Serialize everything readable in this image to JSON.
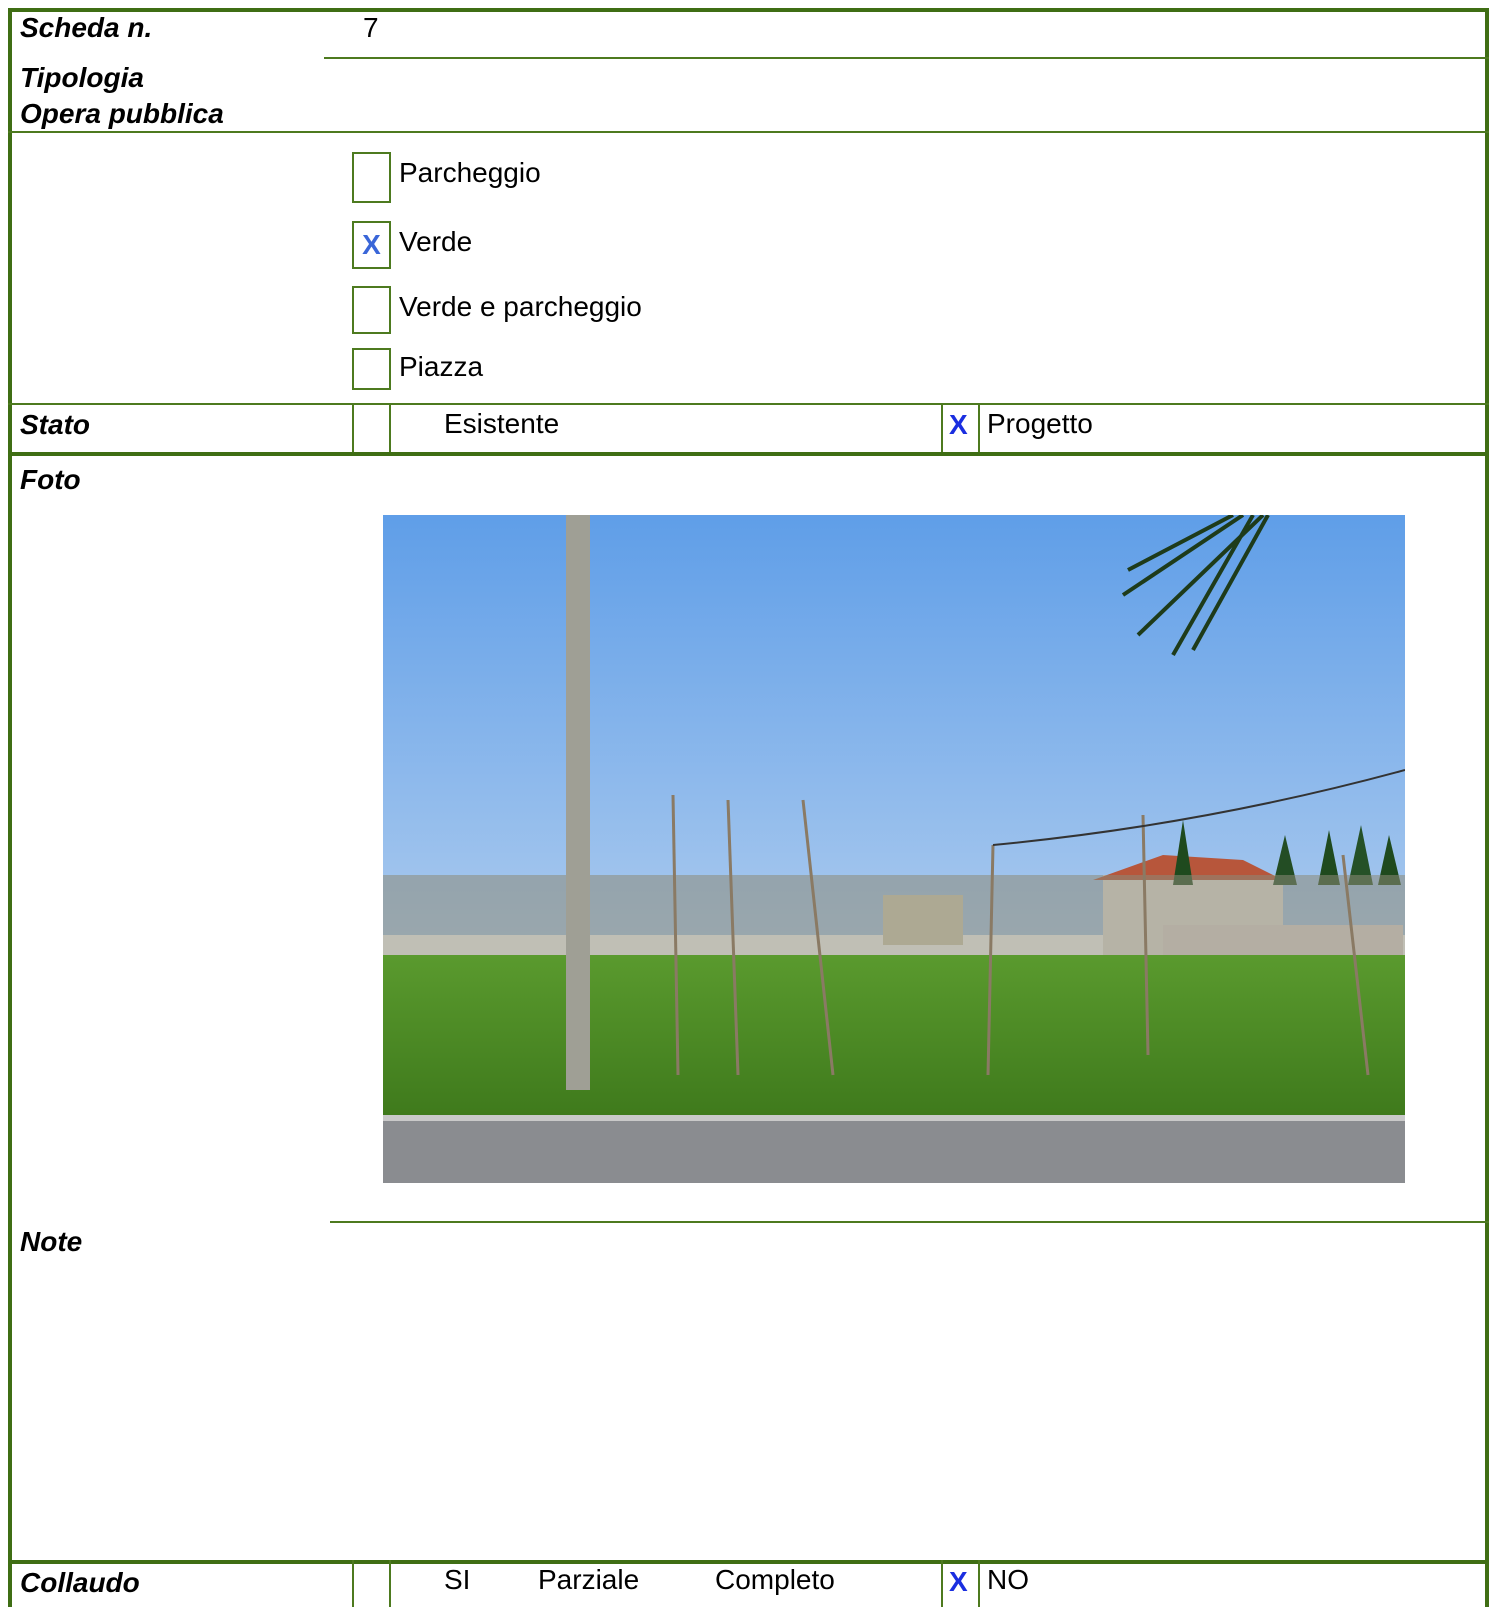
{
  "scheda": {
    "label": "Scheda n.",
    "value": "7"
  },
  "tipologia": {
    "label_line1": "Tipologia",
    "label_line2": "Opera pubblica",
    "options": [
      {
        "label": "Parcheggio",
        "mark": ""
      },
      {
        "label": "Verde",
        "mark": "X"
      },
      {
        "label": "Verde e parcheggio",
        "mark": ""
      },
      {
        "label": "Piazza",
        "mark": ""
      }
    ]
  },
  "stato": {
    "label": "Stato",
    "esistente_mark": "",
    "esistente_label": "Esistente",
    "progetto_mark": "X",
    "progetto_label": "Progetto"
  },
  "foto": {
    "label": "Foto"
  },
  "note": {
    "label": "Note",
    "text": ""
  },
  "collaudo": {
    "label": "Collaudo",
    "si_mark": "",
    "si_label": "SI",
    "parziale_label": "Parziale",
    "completo_label": "Completo",
    "no_mark": "X",
    "no_label": "NO"
  },
  "colors": {
    "border": "#3f6e14",
    "check_x": "#1a2ee0",
    "check_x_light": "#3a66d8"
  }
}
